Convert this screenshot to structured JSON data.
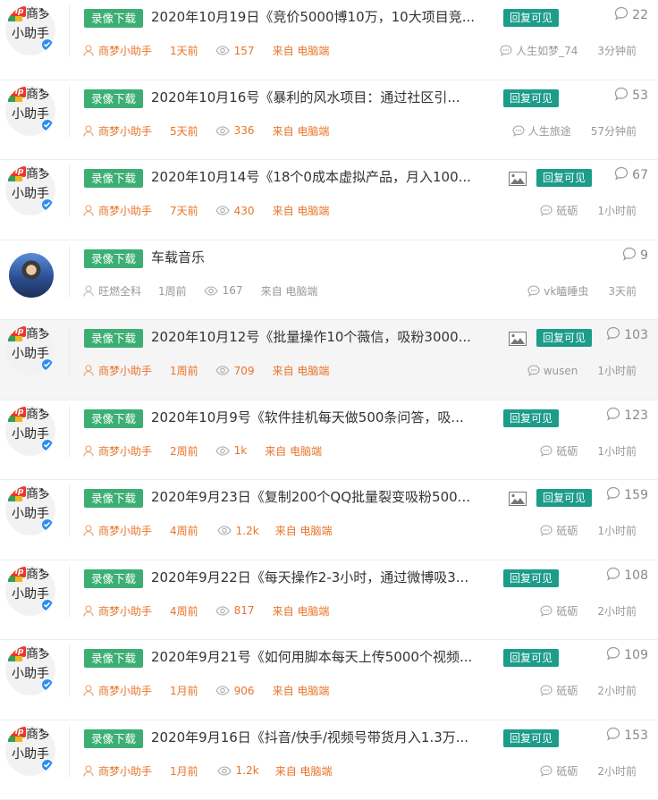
{
  "colors": {
    "tag_green": "#3cae72",
    "reply_teal": "#1c9c8a",
    "author_orange": "#e8742a",
    "meta_gray": "#999999",
    "vip_red": "#e43a2f"
  },
  "rows": [
    {
      "avatar": {
        "type": "vip",
        "vip": "vip",
        "name1": "商梦",
        "name2": "小助手"
      },
      "tag": "录像下载",
      "title": "2020年10月19日《竞价5000博10万，10大项目竞...",
      "has_image": false,
      "reply": "回复可见",
      "comments": "22",
      "author": "商梦小助手",
      "author_orange": true,
      "time": "1天前",
      "views": "157",
      "source": "来自 电脑端",
      "last_user": "人生如梦_74",
      "last_time": "3分钟前",
      "hl": false
    },
    {
      "avatar": {
        "type": "vip",
        "vip": "vip",
        "name1": "商梦",
        "name2": "小助手"
      },
      "tag": "录像下载",
      "title": "2020年10月16号《暴利的风水项目：通过社区引...",
      "has_image": false,
      "reply": "回复可见",
      "comments": "53",
      "author": "商梦小助手",
      "author_orange": true,
      "time": "5天前",
      "views": "336",
      "source": "来自 电脑端",
      "last_user": "人生旅途",
      "last_time": "57分钟前",
      "hl": false
    },
    {
      "avatar": {
        "type": "vip",
        "vip": "vip",
        "name1": "商梦",
        "name2": "小助手"
      },
      "tag": "录像下载",
      "title": "2020年10月14号《18个0成本虚拟产品，月入100...",
      "has_image": true,
      "reply": "回复可见",
      "comments": "67",
      "author": "商梦小助手",
      "author_orange": true,
      "time": "7天前",
      "views": "430",
      "source": "来自 电脑端",
      "last_user": "砥砺",
      "last_time": "1小时前",
      "hl": false
    },
    {
      "avatar": {
        "type": "photo"
      },
      "tag": "录像下载",
      "title": "车载音乐",
      "has_image": false,
      "reply": "",
      "comments": "9",
      "author": "旺燃全科",
      "author_orange": false,
      "time": "1周前",
      "views": "167",
      "source": "来自 电脑端",
      "last_user": "vk瞌睡虫",
      "last_time": "3天前",
      "hl": false
    },
    {
      "avatar": {
        "type": "vip",
        "vip": "vip",
        "name1": "商梦",
        "name2": "小助手"
      },
      "tag": "录像下载",
      "title": "2020年10月12号《批量操作10个薇信，吸粉3000...",
      "has_image": true,
      "reply": "回复可见",
      "comments": "103",
      "author": "商梦小助手",
      "author_orange": true,
      "time": "1周前",
      "views": "709",
      "source": "来自 电脑端",
      "last_user": "wusen",
      "last_time": "1小时前",
      "hl": true
    },
    {
      "avatar": {
        "type": "vip",
        "vip": "vip",
        "name1": "商梦",
        "name2": "小助手"
      },
      "tag": "录像下载",
      "title": "2020年10月9号《软件挂机每天做500条问答，吸...",
      "has_image": false,
      "reply": "回复可见",
      "comments": "123",
      "author": "商梦小助手",
      "author_orange": true,
      "time": "2周前",
      "views": "1k",
      "source": "来自 电脑端",
      "last_user": "砥砺",
      "last_time": "1小时前",
      "hl": false
    },
    {
      "avatar": {
        "type": "vip",
        "vip": "vip",
        "name1": "商梦",
        "name2": "小助手"
      },
      "tag": "录像下载",
      "title": "2020年9月23日《复制200个QQ批量裂变吸粉500...",
      "has_image": true,
      "reply": "回复可见",
      "comments": "159",
      "author": "商梦小助手",
      "author_orange": true,
      "time": "4周前",
      "views": "1.2k",
      "source": "来自 电脑端",
      "last_user": "砥砺",
      "last_time": "1小时前",
      "hl": false
    },
    {
      "avatar": {
        "type": "vip",
        "vip": "vip",
        "name1": "商梦",
        "name2": "小助手"
      },
      "tag": "录像下载",
      "title": "2020年9月22日《每天操作2-3小时，通过微博吸3...",
      "has_image": false,
      "reply": "回复可见",
      "comments": "108",
      "author": "商梦小助手",
      "author_orange": true,
      "time": "4周前",
      "views": "817",
      "source": "来自 电脑端",
      "last_user": "砥砺",
      "last_time": "2小时前",
      "hl": false
    },
    {
      "avatar": {
        "type": "vip",
        "vip": "vip",
        "name1": "商梦",
        "name2": "小助手"
      },
      "tag": "录像下载",
      "title": "2020年9月21号《如何用脚本每天上传5000个视频...",
      "has_image": false,
      "reply": "回复可见",
      "comments": "109",
      "author": "商梦小助手",
      "author_orange": true,
      "time": "1月前",
      "views": "906",
      "source": "来自 电脑端",
      "last_user": "砥砺",
      "last_time": "2小时前",
      "hl": false
    },
    {
      "avatar": {
        "type": "vip",
        "vip": "vip",
        "name1": "商梦",
        "name2": "小助手"
      },
      "tag": "录像下载",
      "title": "2020年9月16日《抖音/快手/视频号带货月入1.3万...",
      "has_image": false,
      "reply": "回复可见",
      "comments": "153",
      "author": "商梦小助手",
      "author_orange": true,
      "time": "1月前",
      "views": "1.2k",
      "source": "来自 电脑端",
      "last_user": "砥砺",
      "last_time": "2小时前",
      "hl": false
    }
  ]
}
